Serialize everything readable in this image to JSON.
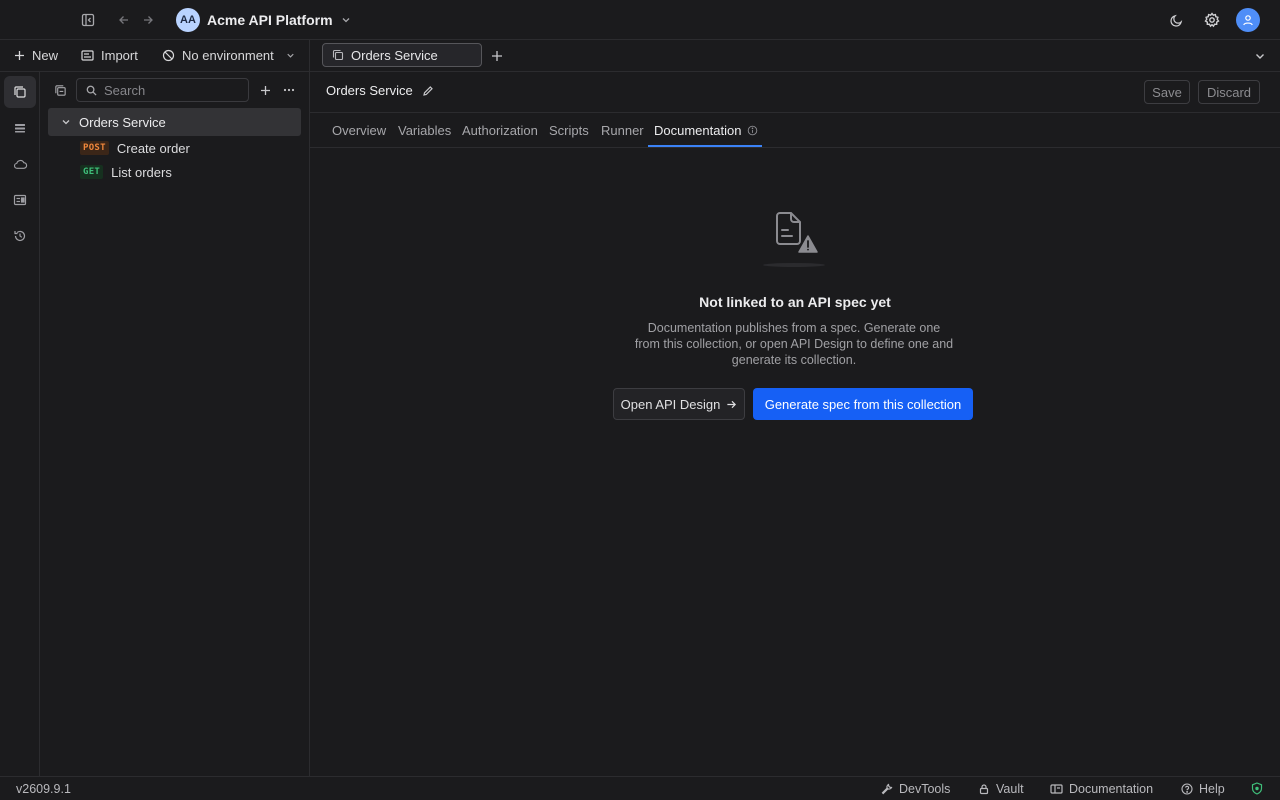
{
  "topbar": {
    "workspace_initials": "AA",
    "workspace_name": "Acme API Platform",
    "icons": [
      "sidebar-toggle-icon",
      "back-arrow-icon",
      "forward-arrow-icon",
      "chevron-down-icon",
      "moon-icon",
      "settings-icon",
      "user-icon"
    ]
  },
  "toolbar": {
    "new_label": "New",
    "import_label": "Import",
    "environment_label": "No environment",
    "open_tab_label": "Orders Service"
  },
  "sidebar": {
    "search_placeholder": "Search",
    "collection": {
      "name": "Orders Service",
      "requests": [
        {
          "method": "POST",
          "name": "Create order",
          "method_color": "#f0873b"
        },
        {
          "method": "GET",
          "name": "List orders",
          "method_color": "#3fbf7a"
        }
      ]
    }
  },
  "main": {
    "title": "Orders Service",
    "save_label": "Save",
    "discard_label": "Discard",
    "tabs": [
      {
        "label": "Overview"
      },
      {
        "label": "Variables"
      },
      {
        "label": "Authorization"
      },
      {
        "label": "Scripts"
      },
      {
        "label": "Runner"
      },
      {
        "label": "Documentation",
        "active": true
      }
    ],
    "empty_state": {
      "icon": "document-warning-icon",
      "title": "Not linked to an API spec yet",
      "description": "Documentation publishes from a spec. Generate one from this collection, or open API Design to define one and generate its collection.",
      "secondary_button": "Open API Design",
      "primary_button": "Generate spec from this collection"
    }
  },
  "statusbar": {
    "version": "v2609.9.1",
    "devtools_label": "DevTools",
    "vault_label": "Vault",
    "documentation_label": "Documentation",
    "help_label": "Help"
  },
  "colors": {
    "accent": "#1660f5",
    "tab_underline": "#3b82f6",
    "background": "#1b1b1d"
  }
}
